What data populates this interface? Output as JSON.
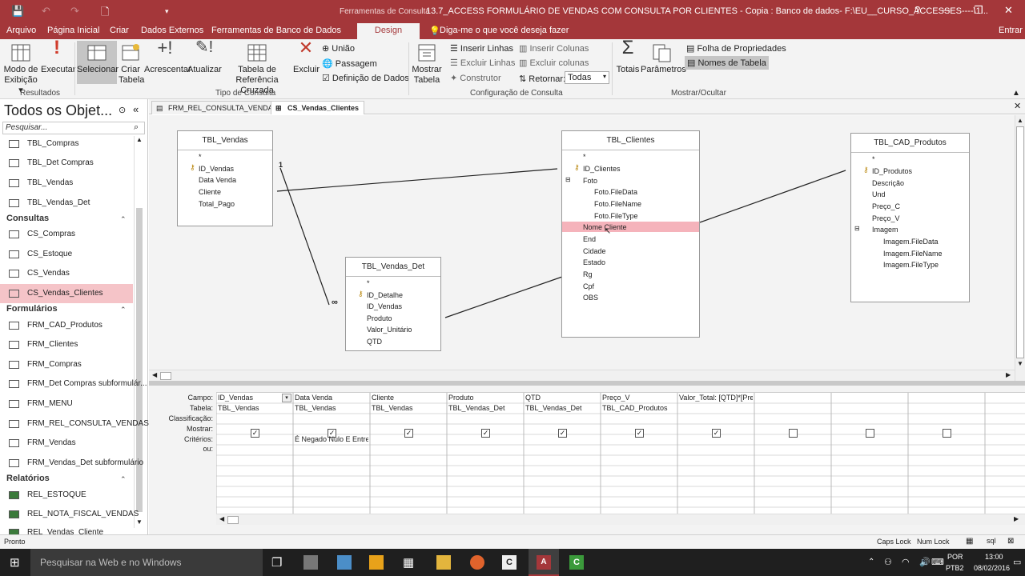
{
  "title_bar": {
    "context_label": "Ferramentas de Consulta",
    "title": "13.7_ACCESS FORMULÁRIO DE VENDAS COM CONSULTA POR CLIENTES - Copia : Banco de dados- F:\\EU__CURSO_ACCESSES----\\1...",
    "help": "?",
    "minimize": "─",
    "restore": "❐",
    "close": "✕"
  },
  "menu": {
    "items": [
      "Arquivo",
      "Página Inicial",
      "Criar",
      "Dados Externos",
      "Ferramentas de Banco de Dados",
      "Design"
    ],
    "tell_me": "Diga-me o que você deseja fazer",
    "signin": "Entrar"
  },
  "ribbon": {
    "view": "Modo de\nExibição ▾",
    "run": "Executar",
    "select": "Selecionar",
    "make_table": "Criar\nTabela",
    "append": "Acrescentar",
    "update": "Atualizar",
    "crosstab": "Tabela de\nReferência Cruzada",
    "delete": "Excluir",
    "union": "União",
    "passthrough": "Passagem",
    "data_def": "Definição de Dados",
    "show_table": "Mostrar\nTabela",
    "insert_rows": "Inserir Linhas",
    "delete_rows": "Excluir Linhas",
    "builder": "Construtor",
    "insert_cols": "Inserir Colunas",
    "delete_cols": "Excluir colunas",
    "return_label": "Retornar:",
    "return_value": "Todas",
    "totals": "Totais",
    "params": "Parâmetros",
    "prop_sheet": "Folha de Propriedades",
    "table_names": "Nomes de Tabela",
    "groups": {
      "results": "Resultados",
      "query_type": "Tipo de Consulta",
      "query_setup": "Configuração de Consulta",
      "show_hide": "Mostrar/Ocultar"
    }
  },
  "nav": {
    "title": "Todos os Objet...",
    "search_placeholder": "Pesquisar...",
    "tables": [
      "TBL_Compras",
      "TBL_Det Compras",
      "TBL_Vendas",
      "TBL_Vendas_Det"
    ],
    "queries_header": "Consultas",
    "queries": [
      "CS_Compras",
      "CS_Estoque",
      "CS_Vendas",
      "CS_Vendas_Clientes"
    ],
    "forms_header": "Formulários",
    "forms": [
      "FRM_CAD_Produtos",
      "FRM_Clientes",
      "FRM_Compras",
      "FRM_Det Compras subformulár...",
      "FRM_MENU",
      "FRM_REL_CONSULTA_VENDAS",
      "FRM_Vendas",
      "FRM_Vendas_Det subformulário"
    ],
    "reports_header": "Relatórios",
    "reports": [
      "REL_ESTOQUE",
      "REL_NOTA_FISCAL_VENDAS",
      "REL_Vendas_Cliente"
    ]
  },
  "doc_tabs": [
    "FRM_REL_CONSULTA_VENDAS",
    "CS_Vendas_Clientes"
  ],
  "tables": {
    "vendas": {
      "name": "TBL_Vendas",
      "fields": [
        "*",
        "ID_Vendas",
        "Data Venda",
        "Cliente",
        "Total_Pago"
      ]
    },
    "vendas_det": {
      "name": "TBL_Vendas_Det",
      "fields": [
        "*",
        "ID_Detalhe",
        "ID_Vendas",
        "Produto",
        "Valor_Unitário",
        "QTD"
      ]
    },
    "clientes": {
      "name": "TBL_Clientes",
      "fields": [
        "*",
        "ID_Clientes",
        "Foto",
        "Foto.FileData",
        "Foto.FileName",
        "Foto.FileType",
        "Nome Cliente",
        "End",
        "Cidade",
        "Estado",
        "Rg",
        "Cpf",
        "OBS"
      ]
    },
    "produtos": {
      "name": "TBL_CAD_Produtos",
      "fields": [
        "*",
        "ID_Produtos",
        "Descrição",
        "Und",
        "Preço_C",
        "Preço_V",
        "Imagem",
        "Imagem.FileData",
        "Imagem.FileName",
        "Imagem.FileType"
      ]
    }
  },
  "join_labels": {
    "one": "1",
    "many": "∞"
  },
  "grid": {
    "row_labels": [
      "Campo:",
      "Tabela:",
      "Classificação:",
      "Mostrar:",
      "Critérios:",
      "ou:"
    ],
    "columns": [
      {
        "field": "ID_Vendas",
        "table": "TBL_Vendas",
        "show": true,
        "criteria": ""
      },
      {
        "field": "Data Venda",
        "table": "TBL_Vendas",
        "show": true,
        "criteria": "É Negado Nulo E Entre"
      },
      {
        "field": "Cliente",
        "table": "TBL_Vendas",
        "show": true,
        "criteria": ""
      },
      {
        "field": "Produto",
        "table": "TBL_Vendas_Det",
        "show": true,
        "criteria": ""
      },
      {
        "field": "QTD",
        "table": "TBL_Vendas_Det",
        "show": true,
        "criteria": ""
      },
      {
        "field": "Preço_V",
        "table": "TBL_CAD_Produtos",
        "show": true,
        "criteria": ""
      },
      {
        "field": "Valor_Total: [QTD]*[Preç",
        "table": "",
        "show": true,
        "criteria": ""
      },
      {
        "field": "",
        "table": "",
        "show": false,
        "criteria": ""
      },
      {
        "field": "",
        "table": "",
        "show": false,
        "criteria": ""
      },
      {
        "field": "",
        "table": "",
        "show": false,
        "criteria": ""
      }
    ]
  },
  "status": {
    "left": "Pronto",
    "caps": "Caps Lock",
    "num": "Num Lock"
  },
  "taskbar": {
    "search": "Pesquisar na Web e no Windows",
    "lang": "POR",
    "layout": "PTB2",
    "time": "13:00",
    "date": "08/02/2016"
  },
  "colors": {
    "accent": "#a4373a",
    "selection": "#f5c4c8"
  }
}
